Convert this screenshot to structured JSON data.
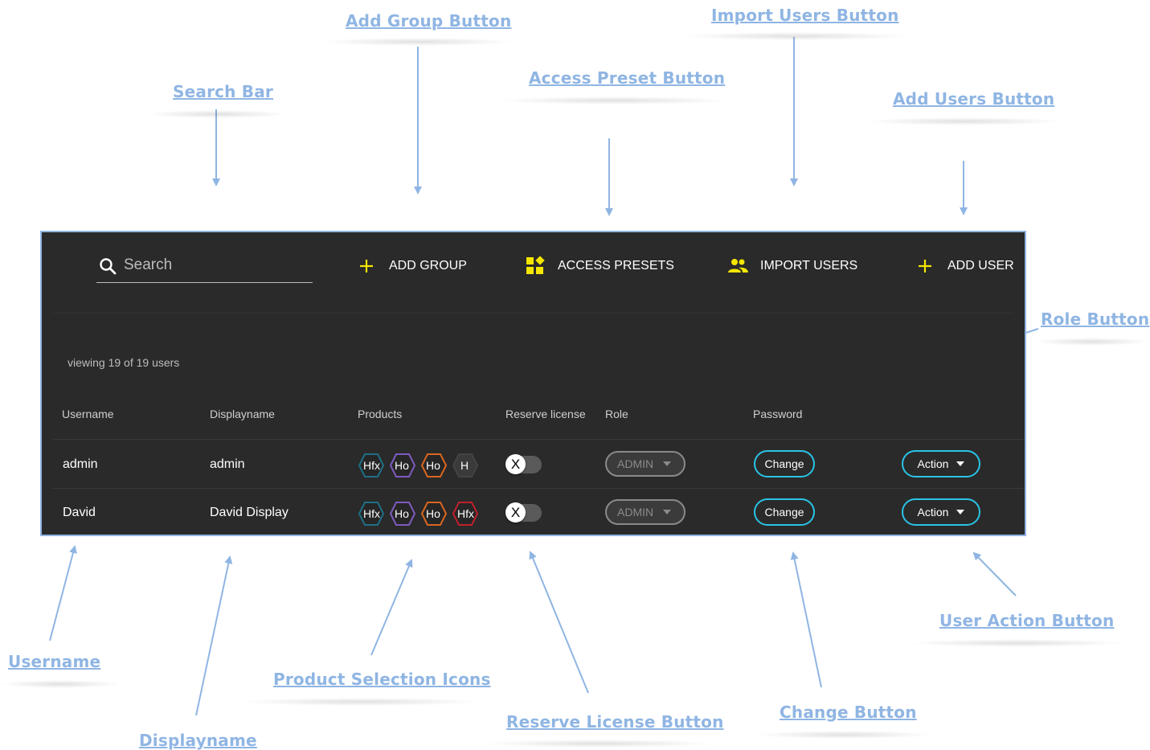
{
  "annotations": {
    "add_group_button": "Add Group Button",
    "import_users_button": "Import Users Button",
    "search_bar": "Search Bar",
    "access_preset_button": "Access Preset Button",
    "add_users_button": "Add Users Button",
    "role_button": "Role Button",
    "user_action_button": "User Action Button",
    "username": "Username",
    "displayname": "Displayname",
    "product_selection_icons": "Product Selection Icons",
    "reserve_license_button": "Reserve License Button",
    "change_button": "Change Button"
  },
  "toolbar": {
    "search_placeholder": "Search",
    "add_group": "ADD GROUP",
    "access_presets": "ACCESS PRESETS",
    "import_users": "IMPORT USERS",
    "add_user": "ADD USER"
  },
  "viewing": "viewing 19 of 19 users",
  "table": {
    "headers": {
      "username": "Username",
      "displayname": "Displayname",
      "products": "Products",
      "reserve": "Reserve license",
      "role": "Role",
      "password": "Password"
    },
    "rows": [
      {
        "username": "admin",
        "displayname": "admin",
        "products": [
          "Hfx",
          "Ho",
          "Ho",
          "H"
        ],
        "reserve_knob": "X",
        "role": "ADMIN",
        "change": "Change",
        "action": "Action"
      },
      {
        "username": "David",
        "displayname": "David Display",
        "products": [
          "Hfx",
          "Ho",
          "Ho",
          "Hfx"
        ],
        "reserve_knob": "X",
        "role": "ADMIN",
        "change": "Change",
        "action": "Action"
      }
    ]
  },
  "colors": {
    "accent_yellow": "#f5e600",
    "pill_border": "#29c4e6",
    "annotation": "#8fb5e3",
    "panel_bg": "#2a2a2a",
    "product_teal": "#1f6f86",
    "product_purple": "#7d5bbf",
    "product_orange": "#d9661f",
    "product_gray": "#444444",
    "product_red": "#c0202c"
  },
  "icons": {
    "search": "search-icon",
    "add_group": "plus-icon",
    "access_presets": "widgets-icon",
    "import_users": "group-icon",
    "add_user": "plus-icon",
    "role_caret": "caret-down-icon",
    "action_caret": "caret-down-icon"
  }
}
